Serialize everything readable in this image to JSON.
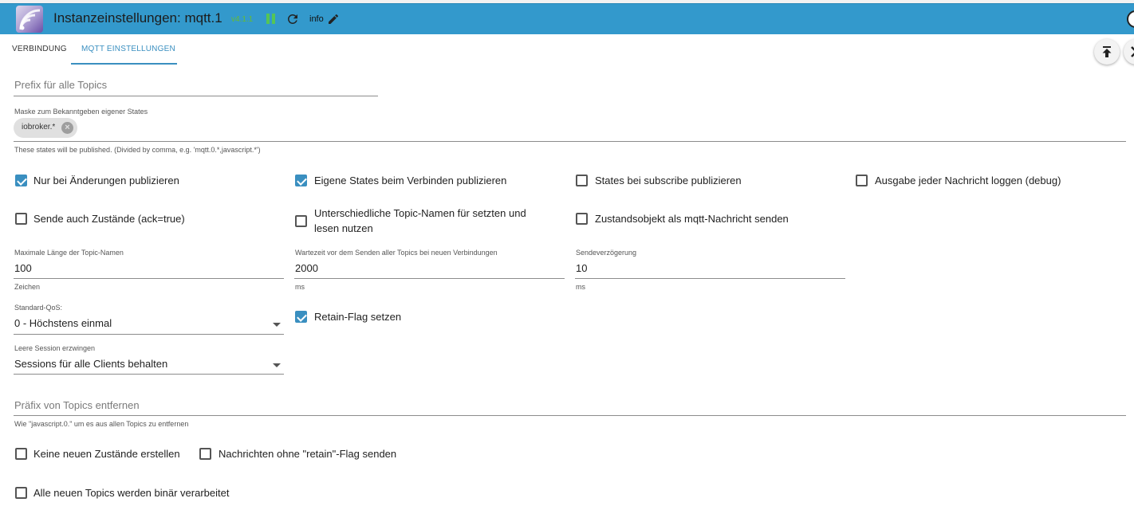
{
  "header": {
    "title": "Instanzeinstellungen: mqtt.1",
    "version": "v4.1.1",
    "info_label": "info",
    "colors": {
      "bar": "#3399cc",
      "version": "#66bb33",
      "pause": "#55c555"
    },
    "icons": [
      "adapter-logo",
      "pause-icon",
      "refresh-icon",
      "edit-icon"
    ]
  },
  "tabs": [
    {
      "label": "VERBINDUNG",
      "active": false
    },
    {
      "label": "MQTT EINSTELLUNGEN",
      "active": true
    }
  ],
  "fabs": [
    "upload-icon",
    "close-icon"
  ],
  "form": {
    "prefix": {
      "placeholder": "Prefix für alle Topics",
      "value": ""
    },
    "mask": {
      "label": "Maske zum Bekanntgeben eigener States",
      "chips": [
        "iobroker.*"
      ],
      "helper": "These states will be published. (Divided by comma, e.g. 'mqtt.0.*,javascript.*')"
    },
    "checkboxes_row1": [
      {
        "label": "Nur bei Änderungen publizieren",
        "checked": true
      },
      {
        "label": "Eigene States beim Verbinden publizieren",
        "checked": true
      },
      {
        "label": "States bei subscribe publizieren",
        "checked": false
      },
      {
        "label": "Ausgabe jeder Nachricht loggen (debug)",
        "checked": false
      }
    ],
    "checkboxes_row2": [
      {
        "label": "Sende auch Zustände (ack=true)",
        "checked": false
      },
      {
        "label_line1": "Unterschiedliche Topic-Namen für setzten und",
        "label_line2": "lesen nutzen",
        "checked": false
      },
      {
        "label": "Zustandsobjekt als mqtt-Nachricht senden",
        "checked": false
      }
    ],
    "max_topic_length": {
      "label": "Maximale Länge der Topic-Namen",
      "value": "100",
      "unit": "Zeichen"
    },
    "wait_time": {
      "label": "Wartezeit vor dem Senden aller Topics bei neuen Verbindungen",
      "value": "2000",
      "unit": "ms"
    },
    "send_delay": {
      "label": "Sendeverzögerung",
      "value": "10",
      "unit": "ms"
    },
    "qos": {
      "label": "Standard-QoS:",
      "value": "0 - Höchstens einmal"
    },
    "retain": {
      "label": "Retain-Flag setzen",
      "checked": true
    },
    "session": {
      "label": "Leere Session erzwingen",
      "value": "Sessions für alle Clients behalten"
    },
    "remove_prefix": {
      "placeholder": "Präfix von Topics entfernen",
      "helper": "Wie \"javascript.0.\" um es aus allen Topics zu entfernen"
    },
    "checkboxes_row3": [
      {
        "label": "Keine neuen Zustände erstellen",
        "checked": false
      },
      {
        "label": "Nachrichten ohne \"retain\"-Flag senden",
        "checked": false
      }
    ],
    "binary": {
      "label": "Alle neuen Topics werden binär verarbeitet",
      "checked": false
    },
    "accent_color": "#3a8fc0"
  }
}
